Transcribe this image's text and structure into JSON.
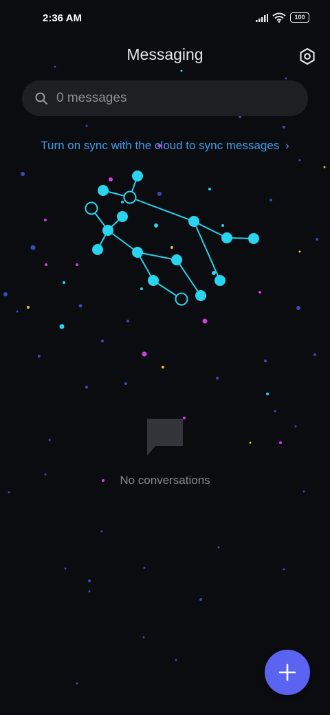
{
  "status_bar": {
    "time": "2:36 AM",
    "battery": "100"
  },
  "header": {
    "title": "Messaging"
  },
  "search": {
    "placeholder": "0 messages"
  },
  "sync_banner": {
    "label": "Turn on sync with the cloud to sync messages"
  },
  "empty_state": {
    "label": "No conversations"
  },
  "fab": {
    "icon": "plus-icon"
  },
  "colors": {
    "accent": "#3d9be9",
    "constellation": "#29d4ef",
    "fab": "#5b64f0",
    "background": "#0b0c10"
  }
}
